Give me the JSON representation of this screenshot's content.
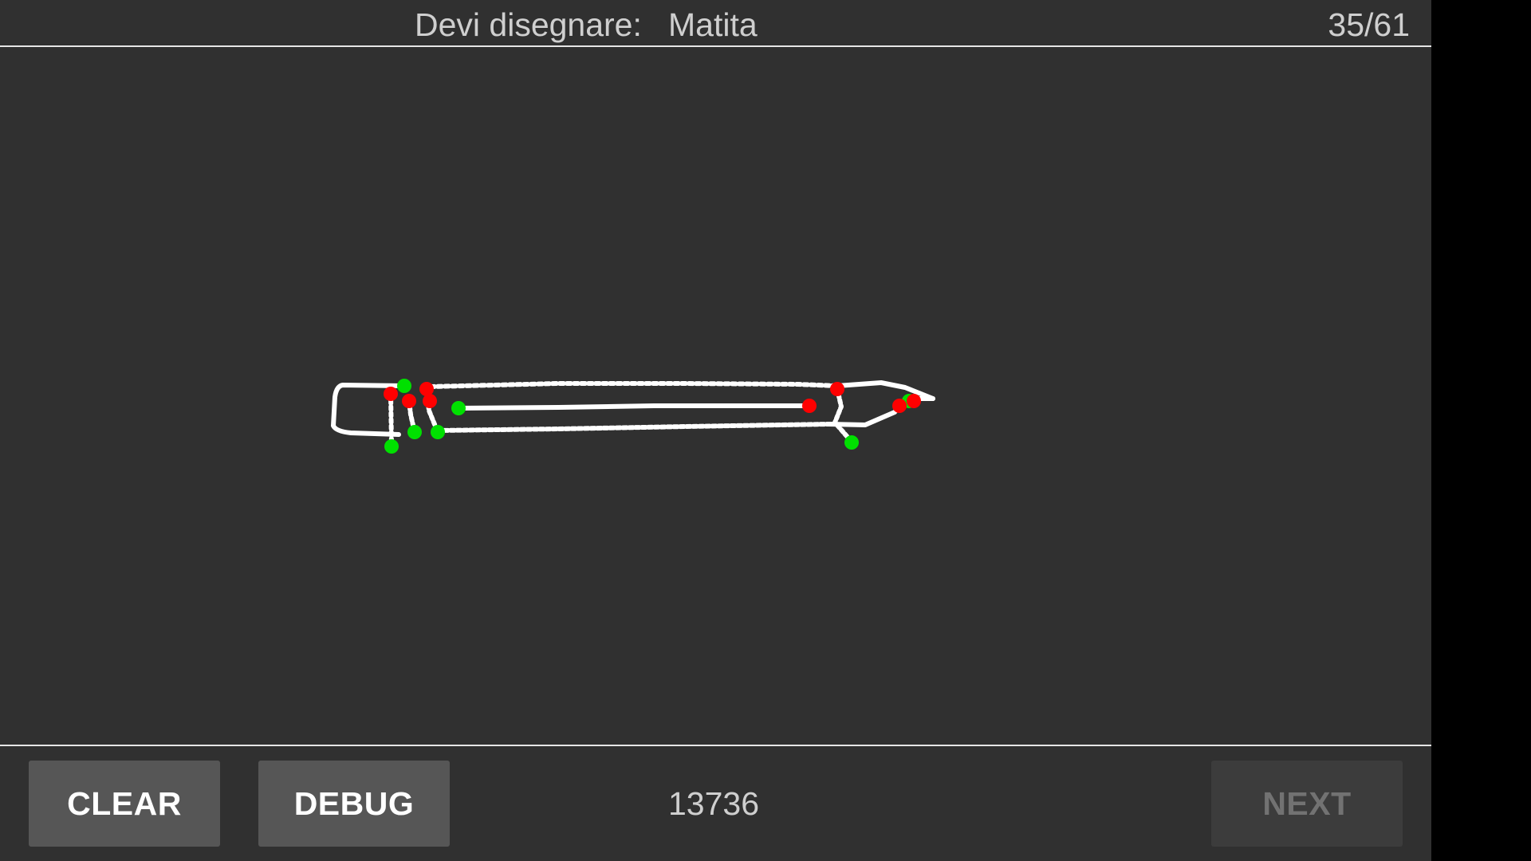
{
  "header": {
    "prompt_label": "Devi disegnare:",
    "prompt_word": "Matita",
    "progress": "35/61"
  },
  "footer": {
    "clear_label": "CLEAR",
    "debug_label": "DEBUG",
    "score": "13736",
    "next_label": "NEXT",
    "next_enabled": false
  },
  "colors": {
    "background": "#303030",
    "stroke": "#ffffff",
    "stroke_start": "#00e000",
    "stroke_end": "#ff0000"
  }
}
